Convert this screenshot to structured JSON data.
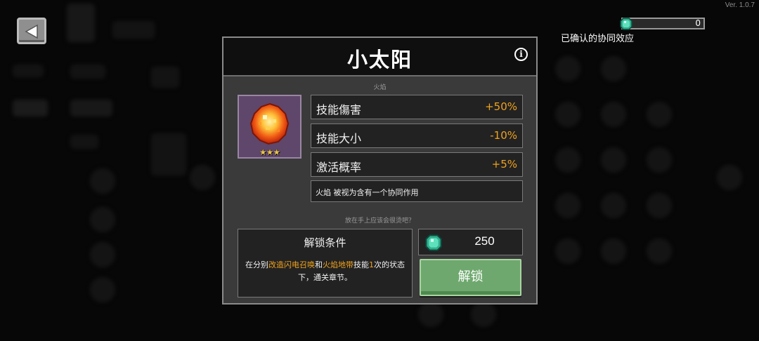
{
  "app": {
    "version": "Ver. 1.0.7"
  },
  "currency": {
    "value": "0",
    "icon": "gem-icon"
  },
  "synergy_label": "已确认的协同效应",
  "modal": {
    "title": "小太阳",
    "info_icon": "info-icon",
    "tag": "火焰",
    "item": {
      "icon": "fireball-icon",
      "stars": "★★★",
      "card_color": "#5f466b"
    },
    "stats": [
      {
        "name": "技能傷害",
        "value": "+50%"
      },
      {
        "name": "技能大小",
        "value": "-10%"
      },
      {
        "name": "激活概率",
        "value": "+5%"
      }
    ],
    "note": "火焰 被视为含有一个协同作用",
    "flavor": "放在手上应该会很烫吧？",
    "unlock": {
      "title": "解锁条件",
      "desc_prefix": "在分别",
      "skill_a": "改造闪电召唤",
      "desc_and": "和",
      "skill_b": "火焰地带",
      "desc_mid": "技能",
      "count": "1",
      "desc_suffix": "次的状态下，通关章节。"
    },
    "cost": {
      "value": "250",
      "icon": "gem-icon"
    },
    "unlock_button": "解锁"
  },
  "colors": {
    "highlight": "#f0a21c",
    "button": "#6ea86e",
    "gem": "#3fc8a0"
  }
}
